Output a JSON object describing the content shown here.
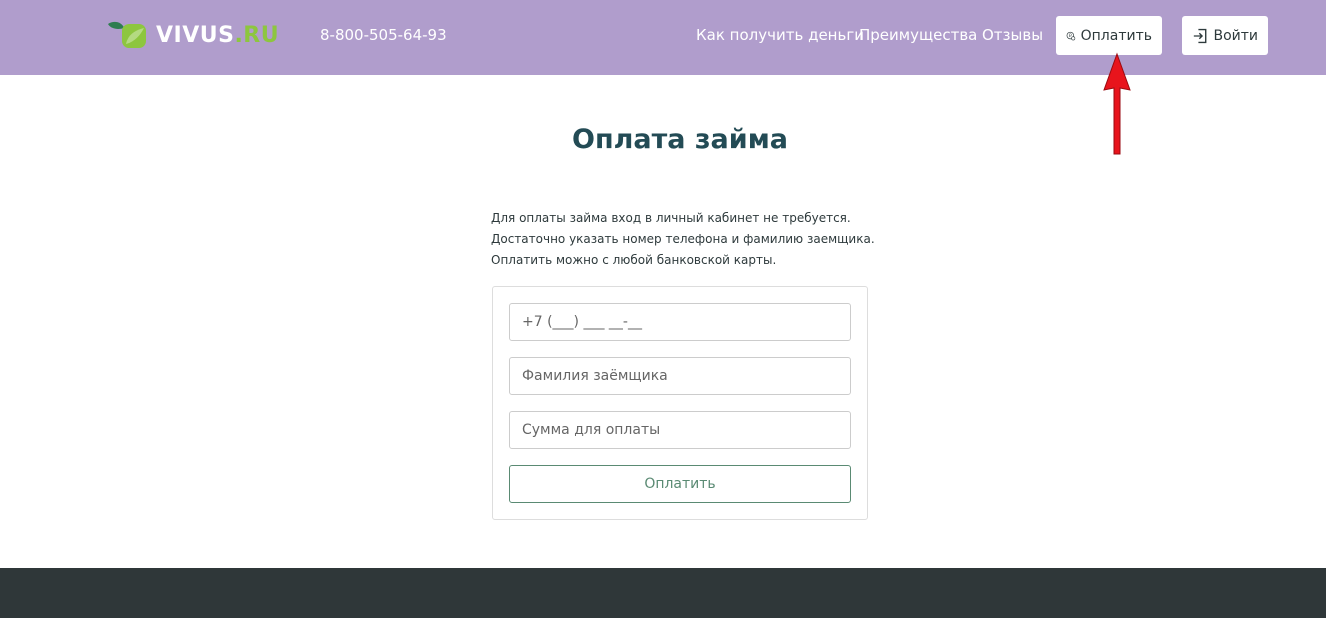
{
  "header": {
    "logo_text": "VIVUS",
    "logo_suffix": ".RU",
    "phone": "8-800-505-64-93",
    "nav": [
      "Как получить деньги",
      "Преимущества",
      "Отзывы"
    ],
    "pay_button": "Оплатить",
    "login_button": "Войти"
  },
  "main": {
    "title": "Оплата займа",
    "intro": [
      "Для оплаты займа вход в личный кабинет не требуется.",
      "Достаточно указать номер телефона и фамилию заемщика.",
      "Оплатить можно с любой банковской карты."
    ],
    "form": {
      "phone_placeholder": "+7 (___) ___ __-__",
      "surname_placeholder": "Фамилия заёмщика",
      "amount_placeholder": "Сумма для оплаты",
      "submit_label": "Оплатить"
    }
  },
  "colors": {
    "header_bg": "#b09dcc",
    "title": "#234b55",
    "accent_green": "#5a8a73",
    "logo_green": "#8dc63f",
    "footer_bg": "#2f3739",
    "annotation_arrow": "#e8141c"
  },
  "icons": {
    "logo": "leaf-logo-icon",
    "pay": "ruble-coin-icon",
    "login": "sign-in-icon",
    "annotation": "red-arrow-icon"
  }
}
